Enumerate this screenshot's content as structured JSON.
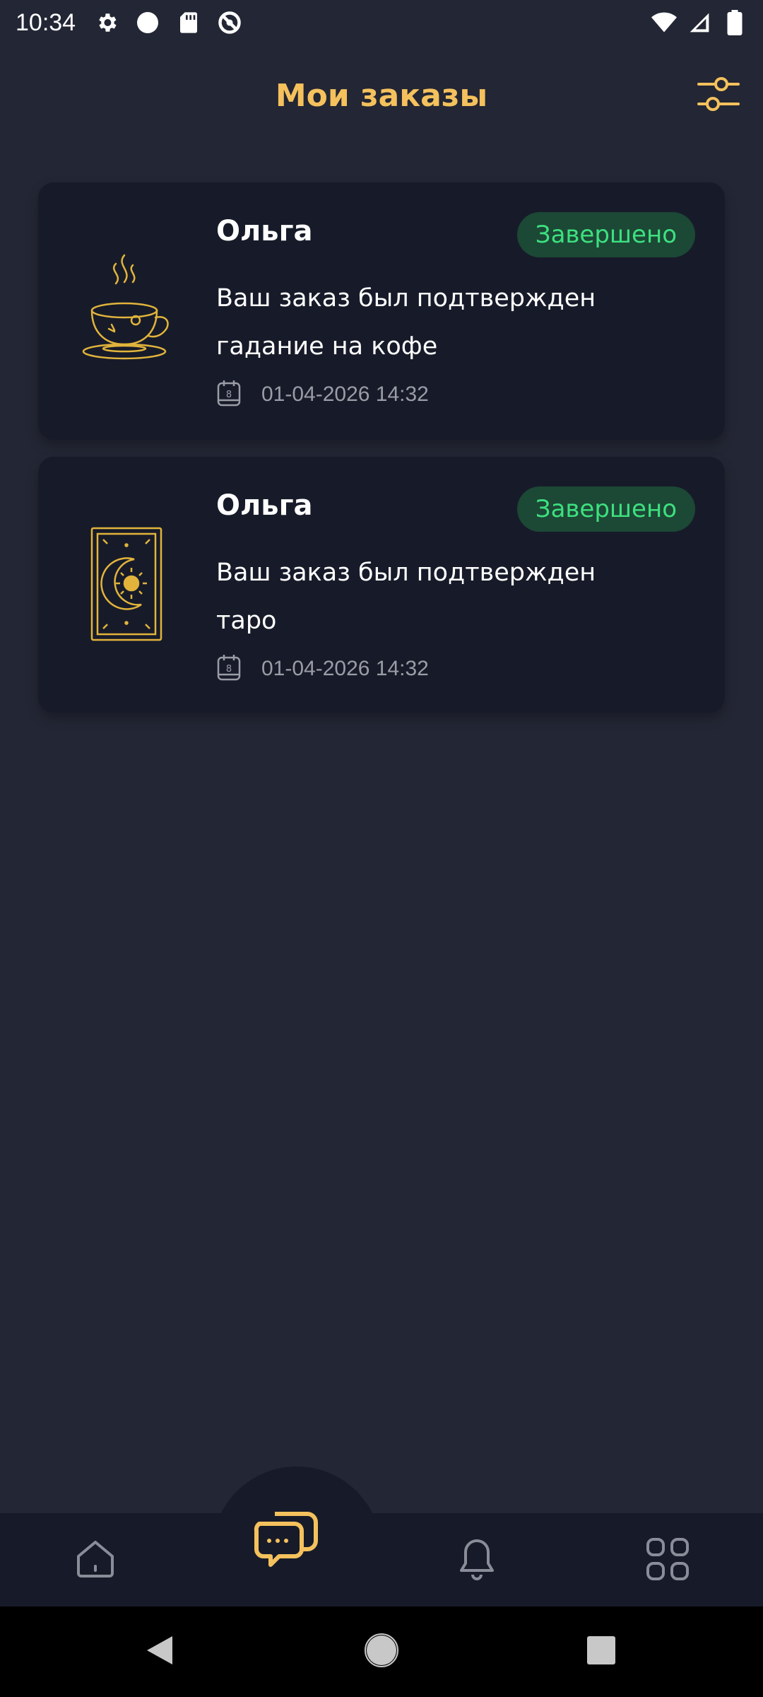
{
  "status_bar": {
    "time": "10:34",
    "left_icons": [
      "gear-icon",
      "circle-icon",
      "sd-card-icon",
      "sync-icon"
    ],
    "right_icons": [
      "wifi-icon",
      "signal-icon",
      "battery-icon"
    ]
  },
  "header": {
    "title": "Мои заказы",
    "title_color": "#f4c15d",
    "filter_icon": "sliders-icon"
  },
  "orders": [
    {
      "name": "Ольга",
      "status": "Завершено",
      "description_line1": "Ваш заказ был подтвержден",
      "description_line2": "гадание на кофе",
      "date": "01-04-2026 14:32",
      "image_icon": "coffee-cup-icon"
    },
    {
      "name": "Ольга",
      "status": "Завершено",
      "description_line1": "Ваш заказ был подтвержден",
      "description_line2": "таро",
      "date": "01-04-2026 14:32",
      "image_icon": "tarot-card-icon"
    }
  ],
  "colors": {
    "background": "#232634",
    "card": "#171b29",
    "accent": "#f4c15d",
    "status_text": "#3de07e",
    "status_bg": "#1c4836"
  },
  "bottom_nav": {
    "items": [
      "home-icon",
      "chat-icon",
      "bell-icon",
      "grid-icon"
    ],
    "active": "chat-icon"
  },
  "system_nav": [
    "back-icon",
    "home-circle-icon",
    "recents-icon"
  ]
}
